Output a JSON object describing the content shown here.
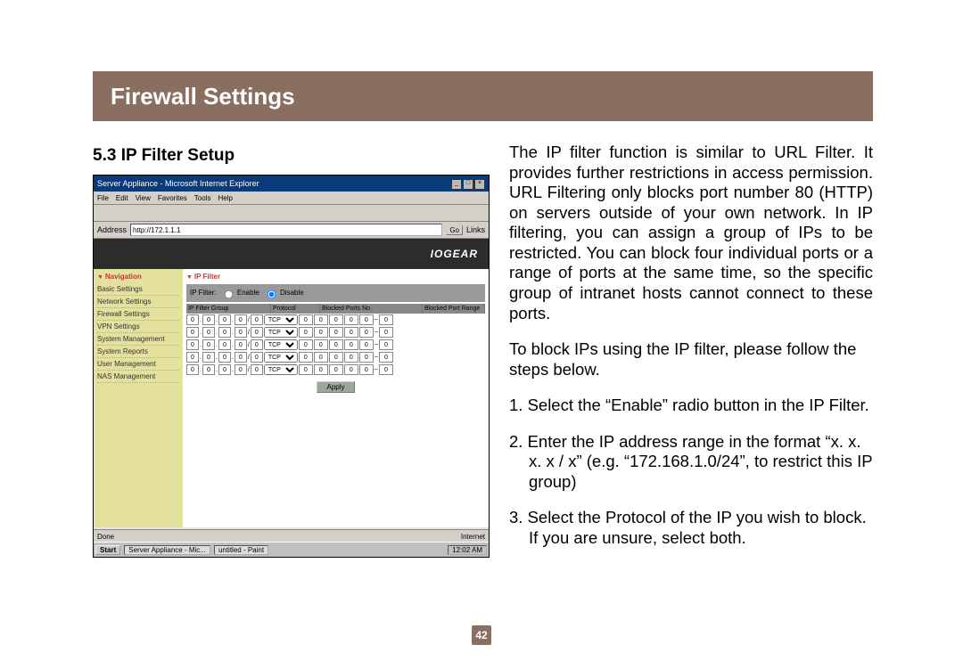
{
  "banner_title": "Firewall Settings",
  "section_heading": "5.3 IP Filter Setup",
  "page_number": "42",
  "ie": {
    "title": "Server Appliance - Microsoft Internet Explorer",
    "menu": [
      "File",
      "Edit",
      "View",
      "Favorites",
      "Tools",
      "Help"
    ],
    "address_label": "Address",
    "address_value": "http://172.1.1.1",
    "go_label": "Go",
    "links_label": "Links",
    "brand": "IOGEAR",
    "nav_title": "Navigation",
    "nav_items": [
      "Basic Settings",
      "Network Settings",
      "Firewall Settings",
      "VPN Settings",
      "System Management",
      "System Reports",
      "User Management",
      "NAS Management"
    ],
    "panel_title": "IP Filter",
    "filter_label": "IP Filter:",
    "enable_label": "Enable",
    "disable_label": "Disable",
    "col_ip": "IP Filter Group",
    "col_proto": "Protocol",
    "col_ports": "Blocked Ports No.",
    "col_range": "Blocked Port Range",
    "proto_option": "TCP",
    "octet_default": "0",
    "mask_default": "0",
    "port_default": "0",
    "apply_label": "Apply",
    "status_done": "Done",
    "status_zone": "Internet",
    "start_label": "Start",
    "task1": "Server Appliance - Mic...",
    "task2": "untitled - Paint",
    "clock": "12:02 AM"
  },
  "body_para1": "The IP filter function is similar to URL Filter. It provides further restrictions in access permission. URL Filtering only blocks port number 80 (HTTP) on servers outside of your own network. In IP filtering, you can assign a group of IPs to be restricted. You can block four individual ports or a range of ports at the same time, so the specific group of intranet hosts cannot connect to these ports.",
  "body_para2": "To block IPs using the IP filter, please follow the steps below.",
  "step1": "1. Select the “Enable” radio button in the IP Filter.",
  "step2": "2. Enter the IP address range in the format “x. x. x. x / x” (e.g. “172.168.1.0/24”, to restrict this IP group)",
  "step3": "3. Select the Protocol of the IP you wish to block.  If you are unsure, select both."
}
